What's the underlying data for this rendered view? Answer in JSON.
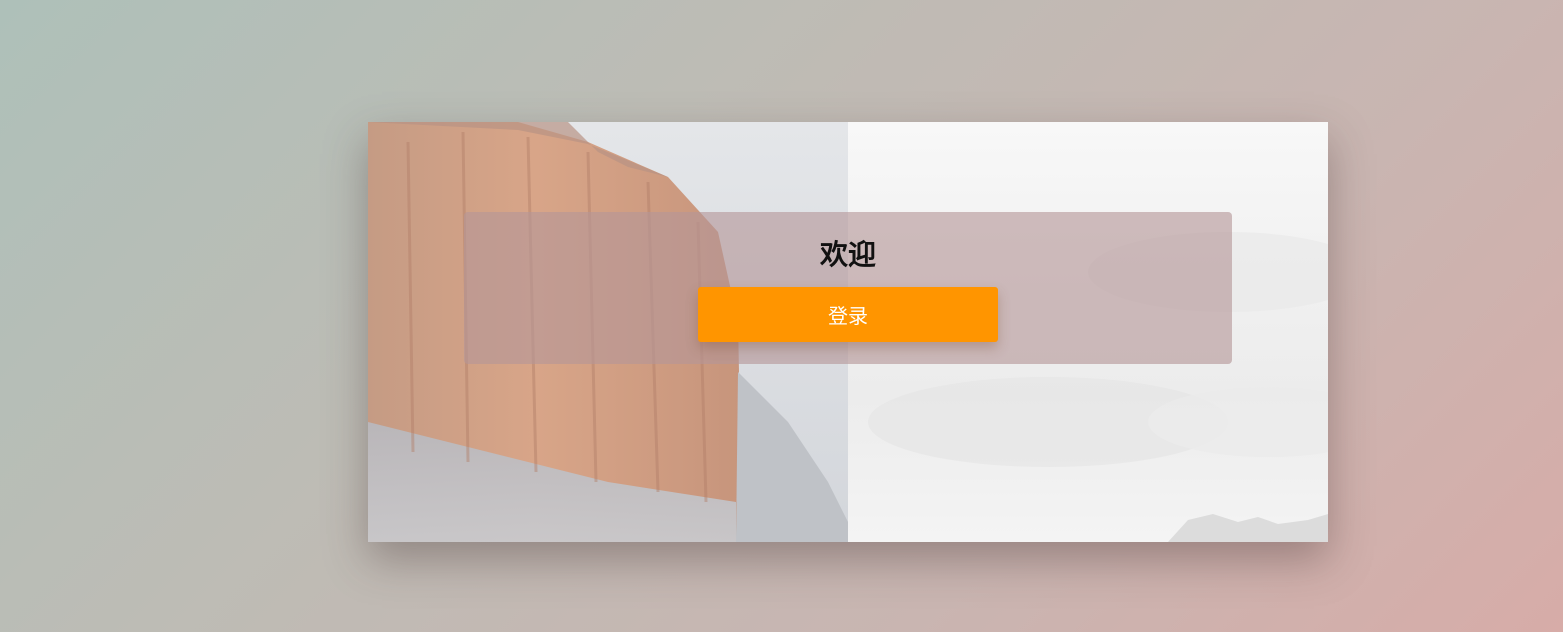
{
  "welcome": {
    "title": "欢迎",
    "login_button_label": "登录"
  },
  "background_image": {
    "icon": "mountain-cliff-photo"
  },
  "colors": {
    "button": "#ff9500",
    "button_text": "#ffffff"
  }
}
